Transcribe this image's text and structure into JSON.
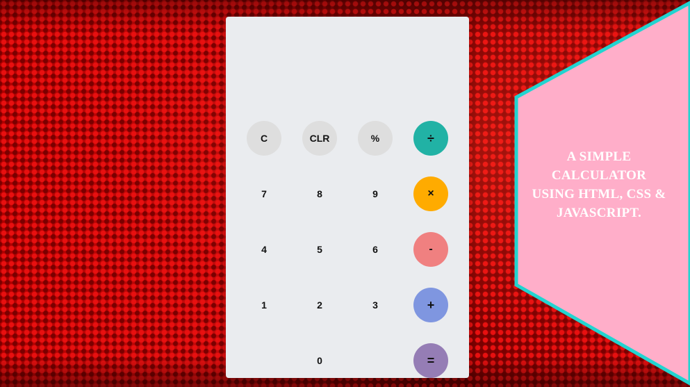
{
  "calculator": {
    "display_value": "",
    "keys": [
      {
        "label": "C",
        "name": "clear-entry-button"
      },
      {
        "label": "CLR",
        "name": "clear-all-button"
      },
      {
        "label": "%",
        "name": "percent-button"
      },
      {
        "label": "÷",
        "name": "divide-button"
      },
      {
        "label": "7",
        "name": "digit-7-button"
      },
      {
        "label": "8",
        "name": "digit-8-button"
      },
      {
        "label": "9",
        "name": "digit-9-button"
      },
      {
        "label": "×",
        "name": "multiply-button"
      },
      {
        "label": "4",
        "name": "digit-4-button"
      },
      {
        "label": "5",
        "name": "digit-5-button"
      },
      {
        "label": "6",
        "name": "digit-6-button"
      },
      {
        "label": "-",
        "name": "subtract-button"
      },
      {
        "label": "1",
        "name": "digit-1-button"
      },
      {
        "label": "2",
        "name": "digit-2-button"
      },
      {
        "label": "3",
        "name": "digit-3-button"
      },
      {
        "label": "+",
        "name": "add-button"
      },
      {
        "label": "0",
        "name": "digit-0-button"
      },
      {
        "label": "=",
        "name": "equals-button"
      }
    ],
    "colors": {
      "panel": "#eaecef",
      "function_key": "#dedede",
      "divide": "#21b2a5",
      "multiply": "#ffab00",
      "subtract": "#f08080",
      "add": "#7f96e0",
      "equals": "#957db5"
    }
  },
  "banner": {
    "text": "A SIMPLE CALCULATOR USING HTML, CSS & JAVASCRIPT.",
    "colors": {
      "fill": "#ffaec9",
      "border": "#21d4d0"
    }
  }
}
